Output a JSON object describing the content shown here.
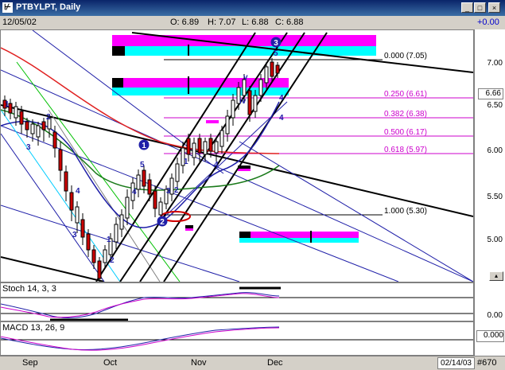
{
  "window": {
    "title": "PTBYLPT, Daily",
    "icon": "chart-icon",
    "minimize": "_",
    "maximize": "□",
    "close": "×"
  },
  "info": {
    "date": "12/05/02",
    "open": "O: 6.89",
    "high": "H: 7.07",
    "low": "L: 6.88",
    "close": "C: 6.88",
    "change": "+0.00"
  },
  "colors": {
    "fib": "#cc00cc",
    "magenta_band": "#ff00ff",
    "cyan_band": "#00ffff",
    "up_candle": "#ffffff",
    "down_candle": "#cc0000"
  },
  "price_axis": {
    "ticks": [
      "7.00",
      "6.50",
      "6.00",
      "5.50",
      "5.00"
    ],
    "last_price": "6.66"
  },
  "fib_levels": [
    {
      "label": "0.000 (7.05)",
      "color": "black"
    },
    {
      "label": "0.250 (6.61)",
      "color": "magenta"
    },
    {
      "label": "0.382 (6.38)",
      "color": "magenta"
    },
    {
      "label": "0.500 (6.17)",
      "color": "magenta"
    },
    {
      "label": "0.618 (5.97)",
      "color": "magenta"
    },
    {
      "label": "1.000 (5.30)",
      "color": "black"
    }
  ],
  "wave_labels": [
    "1",
    "2",
    "3",
    "4",
    "5",
    "1",
    "2",
    "3",
    "4",
    "5",
    "1",
    "2",
    "3",
    "4",
    "5",
    "1",
    "2",
    "3",
    "4",
    "5",
    "v",
    "iv",
    "4",
    "4"
  ],
  "circle_labels": [
    "1",
    "2",
    "3"
  ],
  "stoch": {
    "label": "Stoch 14, 3, 3",
    "axis_value": "0.00"
  },
  "macd": {
    "label": "MACD 13, 26, 9",
    "axis_value": "0.000"
  },
  "dates": [
    "Sep",
    "Oct",
    "Nov",
    "Dec"
  ],
  "footer": {
    "end_date": "02/14/03",
    "bar_count": "#670"
  }
}
